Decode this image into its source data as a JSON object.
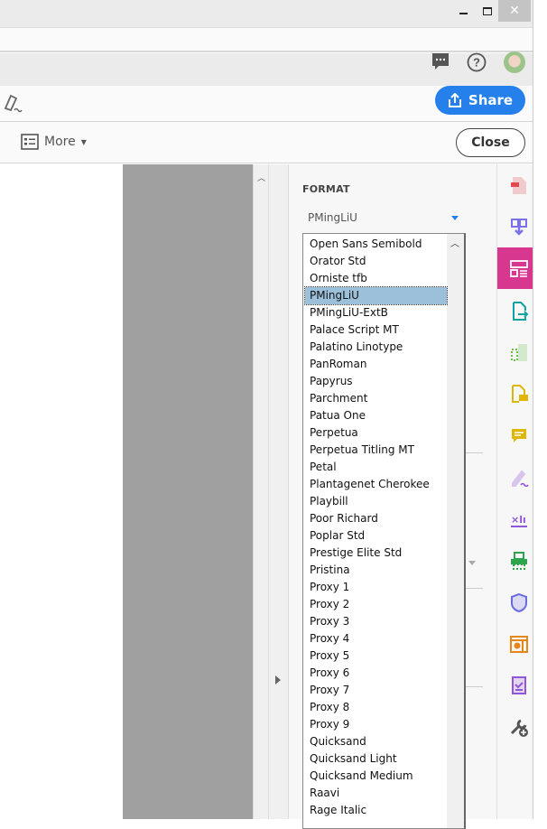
{
  "window": {
    "minimize": "minimize",
    "maximize": "maximize",
    "close": "close"
  },
  "header": {
    "chat_icon": "chat-icon",
    "help_icon": "help-icon",
    "avatar": "user-avatar"
  },
  "toolbar": {
    "share_label": "Share",
    "more_label": "More",
    "close_label": "Close"
  },
  "panel": {
    "heading": "FORMAT",
    "font_select": {
      "value": "PMingLiU"
    },
    "font_list": [
      "Open Sans Semibold",
      "Orator Std",
      "Orniste tfb",
      "PMingLiU",
      "PMingLiU-ExtB",
      "Palace Script MT",
      "Palatino Linotype",
      "PanRoman",
      "Papyrus",
      "Parchment",
      "Patua One",
      "Perpetua",
      "Perpetua Titling MT",
      "Petal",
      "Plantagenet Cherokee",
      "Playbill",
      "Poor Richard",
      "Poplar Std",
      "Prestige Elite Std",
      "Pristina",
      "Proxy 1",
      "Proxy 2",
      "Proxy 3",
      "Proxy 4",
      "Proxy 5",
      "Proxy 6",
      "Proxy 7",
      "Proxy 8",
      "Proxy 9",
      "Quicksand",
      "Quicksand Light",
      "Quicksand Medium",
      "Raavi",
      "Rage Italic"
    ],
    "selected_font": "PMingLiU"
  },
  "tools": [
    {
      "name": "create-pdf",
      "color": "#e34850"
    },
    {
      "name": "combine-files",
      "color": "#7b72e9"
    },
    {
      "name": "edit-pdf",
      "color": "#ffffff",
      "active": true,
      "bg": "#d83790"
    },
    {
      "name": "export-pdf",
      "color": "#12a2a2"
    },
    {
      "name": "organize-pages",
      "color": "#6cc04a"
    },
    {
      "name": "request-signatures",
      "color": "#e0b700"
    },
    {
      "name": "comment",
      "color": "#e0b700"
    },
    {
      "name": "fill-sign",
      "color": "#9256d9"
    },
    {
      "name": "send-for-signature",
      "color": "#9256d9"
    },
    {
      "name": "print-production",
      "color": "#2ea44f"
    },
    {
      "name": "protect",
      "color": "#6b6be0"
    },
    {
      "name": "action-wizard",
      "color": "#e68619"
    },
    {
      "name": "prepare-form",
      "color": "#9256d9"
    },
    {
      "name": "add-tools",
      "color": "#555555"
    }
  ]
}
